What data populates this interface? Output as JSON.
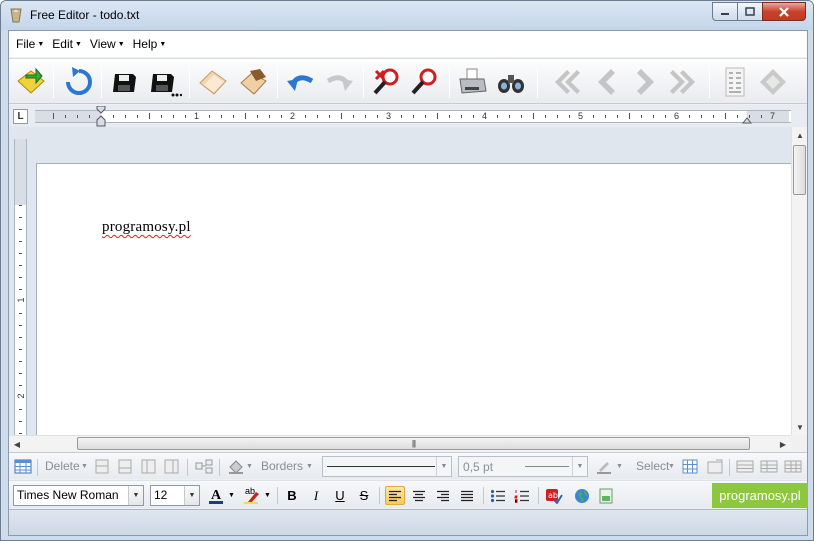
{
  "window": {
    "title": "Free Editor - todo.txt"
  },
  "menu": [
    "File",
    "Edit",
    "View",
    "Help"
  ],
  "toolbar": {
    "icons": [
      "new-document-icon",
      "open-icon",
      "undo-file-icon",
      "save-icon",
      "save-as-icon",
      "copy-icon",
      "paste-icon",
      "undo-icon",
      "redo-icon",
      "find-icon",
      "replace-icon",
      "print-icon",
      "search-binoculars-icon",
      "first-page-icon",
      "previous-page-icon",
      "next-page-icon",
      "last-page-icon",
      "page-layout-icon",
      "diamond-icon"
    ]
  },
  "ruler": {
    "corner_label": "L",
    "numbers": [
      "1",
      "2",
      "3",
      "4",
      "5",
      "6",
      "7"
    ],
    "vertical_numbers": [
      "1",
      "2"
    ]
  },
  "document": {
    "text": "programosy.pl"
  },
  "table_toolbar": {
    "delete_label": "Delete",
    "borders_label": "Borders",
    "width_value": "0,5 pt",
    "select_label": "Select"
  },
  "format_toolbar": {
    "font_name": "Times New Roman",
    "font_size": "12",
    "bold_label": "B",
    "italic_label": "I",
    "underline_label": "U",
    "strike_label": "S",
    "font_color_label": "A",
    "highlight_label": "ab"
  },
  "watermark": "programosy.pl",
  "colors": {
    "accent": "#8dc63f",
    "selection": "#f8c95c",
    "spell_error": "#e02020"
  }
}
